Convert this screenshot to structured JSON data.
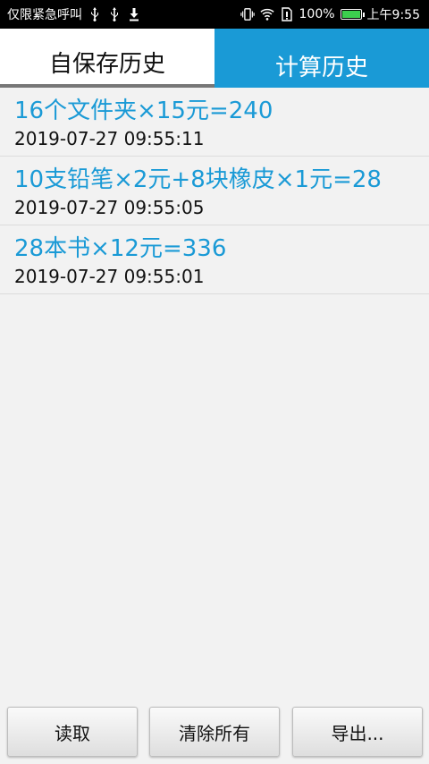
{
  "status_bar": {
    "notification_text": "仅限紧急呼叫",
    "battery": "100%",
    "time": "上午9:55",
    "icons": [
      "usb-icon",
      "usb-icon",
      "download-icon",
      "vibrate-icon",
      "wifi-icon",
      "sim-icon",
      "battery-icon"
    ]
  },
  "tabs": [
    {
      "label": "自保存历史"
    },
    {
      "label": "计算历史"
    }
  ],
  "history": [
    {
      "expression": "16个文件夹×15元=240",
      "time": "2019-07-27 09:55:11"
    },
    {
      "expression": "10支铅笔×2元+8块橡皮×1元=28",
      "time": "2019-07-27 09:55:05"
    },
    {
      "expression": "28本书×12元=336",
      "time": "2019-07-27 09:55:01"
    }
  ],
  "buttons": {
    "read": "读取",
    "clear_all": "清除所有",
    "export": "导出..."
  },
  "colors": {
    "accent": "#1a9ad6",
    "battery_fill": "#3ccf4e"
  }
}
